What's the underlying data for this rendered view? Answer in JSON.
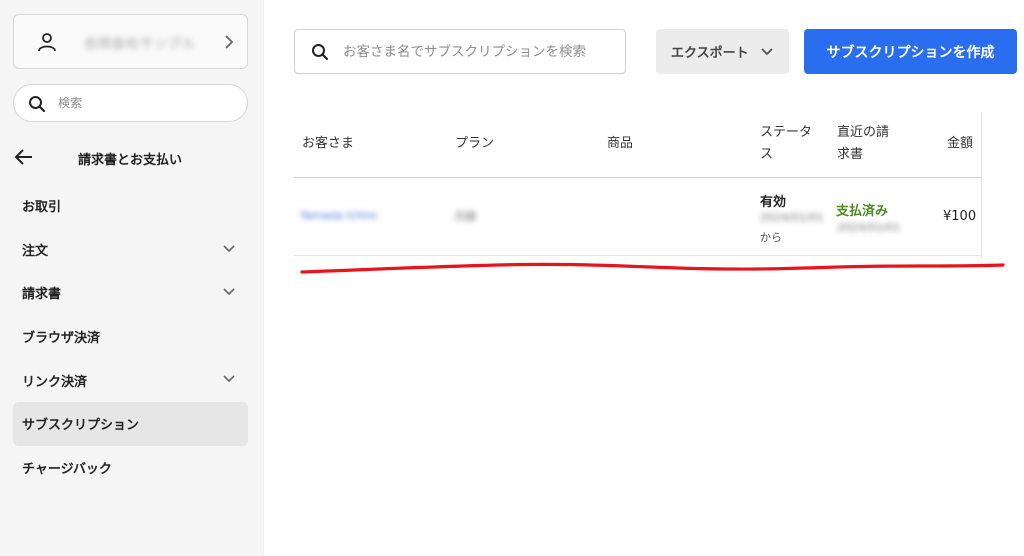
{
  "sidebar": {
    "account_name": "合同会社サンプル",
    "search_placeholder": "検索",
    "back_title": "請求書とお支払い",
    "items": [
      {
        "label": "お取引",
        "has_chevron": false
      },
      {
        "label": "注文",
        "has_chevron": true
      },
      {
        "label": "請求書",
        "has_chevron": true
      },
      {
        "label": "ブラウザ決済",
        "has_chevron": false
      },
      {
        "label": "リンク決済",
        "has_chevron": true
      },
      {
        "label": "サブスクリプション",
        "has_chevron": false,
        "active": true
      },
      {
        "label": "チャージバック",
        "has_chevron": false
      }
    ]
  },
  "toolbar": {
    "search_placeholder": "お客さま名でサブスクリプションを検索",
    "export_label": "エクスポート",
    "create_label": "サブスクリプションを作成"
  },
  "table": {
    "headers": {
      "customer": "お客さま",
      "plan": "プラン",
      "product": "商品",
      "status_line1": "ステータ",
      "status_line2": "ス",
      "invoice_line1": "直近の請",
      "invoice_line2": "求書",
      "amount": "金額"
    },
    "row": {
      "customer": "Yamada Ichiro",
      "plan": "月額",
      "status": "有効",
      "status_date": "2024/01/01",
      "status_suffix": "から",
      "invoice_status": "支払済み",
      "invoice_date": "2024/01/01",
      "amount": "¥100"
    }
  },
  "colors": {
    "primary": "#2a6ef0",
    "paid": "#4b8a1f",
    "link": "#4a73e0",
    "annotation": "#e8141c"
  }
}
